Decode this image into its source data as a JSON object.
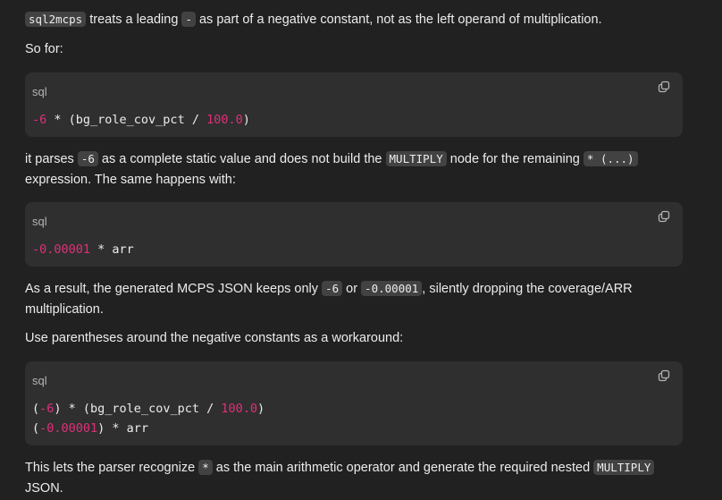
{
  "p1": {
    "code1": "sql2mcps",
    "text1": " treats a leading ",
    "code2": "-",
    "text2": " as part of a negative constant, not as the left operand of multiplication."
  },
  "p2": {
    "text": "So for:"
  },
  "codeblock1": {
    "lang": "sql",
    "num1": "-6",
    "mid": " * (bg_role_cov_pct / ",
    "num2": "100.0",
    "end": ")"
  },
  "p3": {
    "text1": "it parses ",
    "code1": "-6",
    "text2": " as a complete static value and does not build the ",
    "code2": "MULTIPLY",
    "text3": " node for the remaining ",
    "code3": "* (...)",
    "text4": " expression. The same happens with:"
  },
  "codeblock2": {
    "lang": "sql",
    "num1": "-0.00001",
    "rest": " * arr"
  },
  "p4": {
    "text1": "As a result, the generated MCPS JSON keeps only ",
    "code1": "-6",
    "text2": " or ",
    "code2": "-0.00001",
    "text3": ", silently dropping the coverage/ARR multiplication."
  },
  "p5": {
    "text": "Use parentheses around the negative constants as a workaround:"
  },
  "codeblock3": {
    "lang": "sql",
    "line1_open": "(",
    "line1_num1": "-6",
    "line1_mid": ") * (bg_role_cov_pct / ",
    "line1_num2": "100.0",
    "line1_end": ")",
    "line2_open": "(",
    "line2_num1": "-0.00001",
    "line2_rest": ") * arr"
  },
  "p6": {
    "text1": "This lets the parser recognize ",
    "code1": "*",
    "text2": " as the main arithmetic operator and generate the required nested ",
    "code2": "MULTIPLY",
    "text3": " JSON."
  },
  "icons": {
    "copy": "copy-icon"
  },
  "colors": {
    "background": "#212121",
    "code_bg": "#2f2f2f",
    "inline_code_bg": "#424242",
    "number": "#df3079"
  }
}
